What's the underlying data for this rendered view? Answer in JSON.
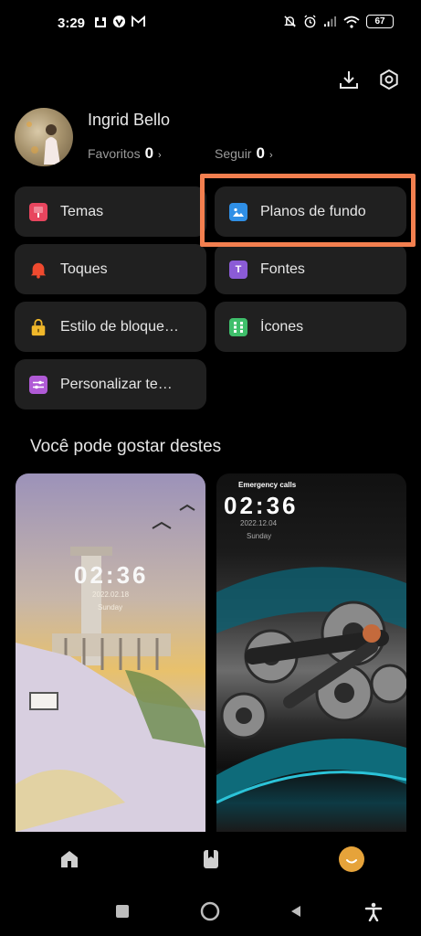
{
  "status_bar": {
    "time": "3:29",
    "battery": "67"
  },
  "profile": {
    "name": "Ingrid Bello",
    "favorites_label": "Favoritos",
    "favorites_count": "0",
    "following_label": "Seguir",
    "following_count": "0"
  },
  "menu": {
    "items": [
      {
        "label": "Temas",
        "icon": "themes-icon",
        "color": "#e8455e"
      },
      {
        "label": "Planos de fundo",
        "icon": "wallpaper-icon",
        "color": "#2f8fe6"
      },
      {
        "label": "Toques",
        "icon": "bell-icon",
        "color": "#ef4a2f"
      },
      {
        "label": "Fontes",
        "icon": "font-icon",
        "color": "#8b5bd6"
      },
      {
        "label": "Estilo de bloque…",
        "icon": "lock-icon",
        "color": "#f0b72a"
      },
      {
        "label": "Ícones",
        "icon": "apps-grid-icon",
        "color": "#3fbf6b"
      },
      {
        "label": "Personalizar te…",
        "icon": "sliders-icon",
        "color": "#b05ad6"
      }
    ],
    "font_icon_glyph": "T"
  },
  "recommend": {
    "title": "Você pode gostar destes",
    "cards": [
      {
        "time": "02:36",
        "date": "2022.02.18",
        "day": "Sunday"
      },
      {
        "carrier": "Emergency calls",
        "time": "02:36",
        "date": "2022.12.04",
        "day": "Sunday"
      }
    ]
  },
  "colors": {
    "highlight": "#f37f4f",
    "tile_bg": "#202020",
    "avatar_accent": "#e6a33a"
  }
}
